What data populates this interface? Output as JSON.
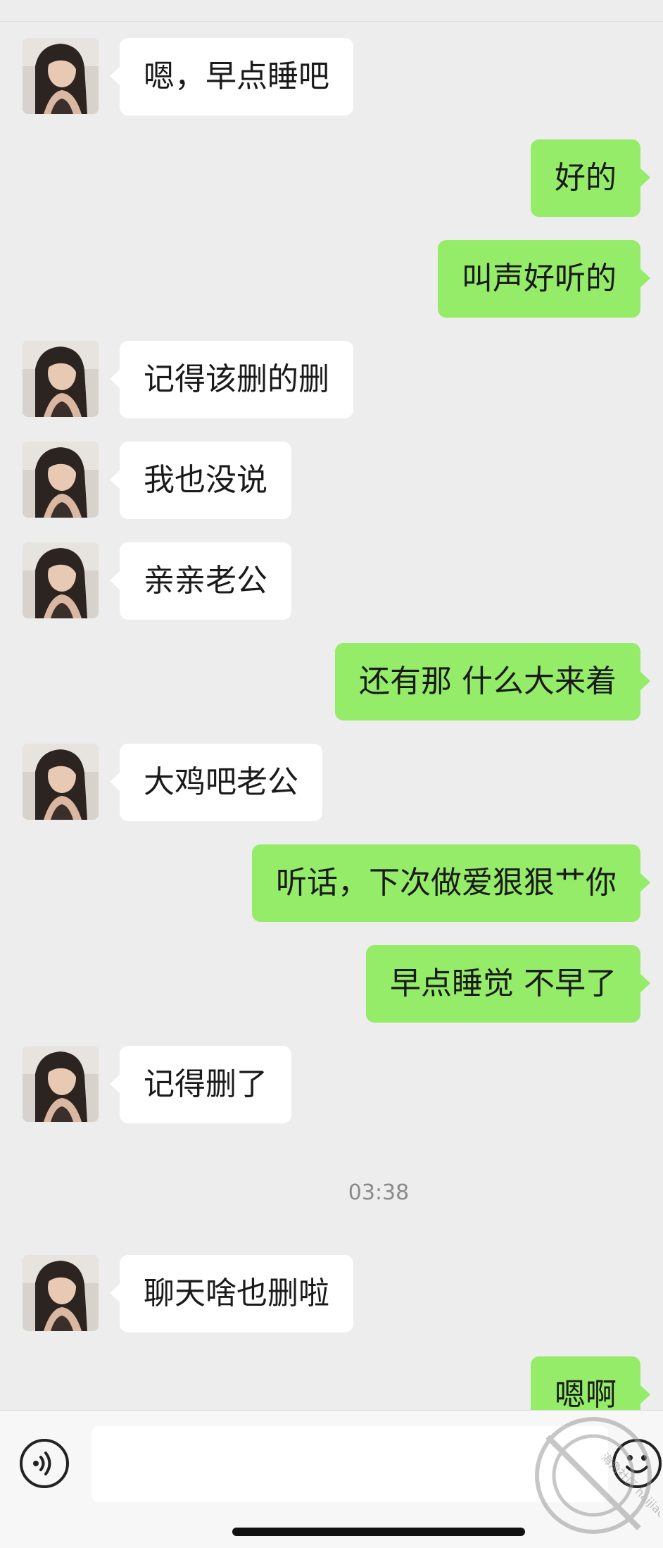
{
  "messages": [
    {
      "side": "left",
      "text": "嗯，早点睡吧"
    },
    {
      "side": "right",
      "text": "好的"
    },
    {
      "side": "right",
      "text": "叫声好听的"
    },
    {
      "side": "left",
      "text": "记得该删的删"
    },
    {
      "side": "left",
      "text": "我也没说"
    },
    {
      "side": "left",
      "text": "亲亲老公"
    },
    {
      "side": "right",
      "text": "还有那 什么大来着"
    },
    {
      "side": "left",
      "text": "大鸡吧老公"
    },
    {
      "side": "right",
      "text": "听话，下次做爱狠狠艹你"
    },
    {
      "side": "right",
      "text": "早点睡觉 不早了"
    },
    {
      "side": "left",
      "text": "记得删了"
    },
    {
      "side": "time",
      "text": "03:38"
    },
    {
      "side": "left",
      "text": "聊天啥也删啦"
    },
    {
      "side": "right",
      "text": "嗯啊"
    }
  ],
  "input_bar": {
    "text_value": "",
    "voice_icon": "voice-icon",
    "emoji_icon": "emoji-icon"
  },
  "watermark": {
    "text": "海角社区 haijiao.com"
  },
  "colors": {
    "background": "#ededed",
    "incoming_bubble": "#ffffff",
    "outgoing_bubble": "#95ec69",
    "timestamp_text": "#8a8a8a"
  }
}
